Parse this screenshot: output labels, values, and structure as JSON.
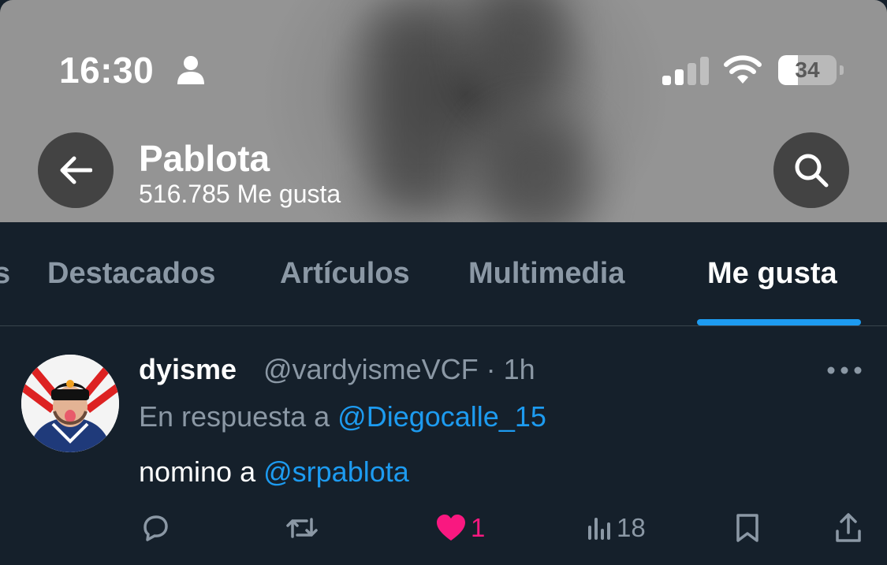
{
  "status_bar": {
    "time": "16:30",
    "battery": "34",
    "battery_level": 0.34
  },
  "header": {
    "profile_name": "Pablota",
    "likes_count": "516.785 Me gusta"
  },
  "tabs": [
    {
      "label": "Destacados",
      "active": false
    },
    {
      "label": "Artículos",
      "active": false
    },
    {
      "label": "Multimedia",
      "active": false
    },
    {
      "label": "Me gusta",
      "active": true
    }
  ],
  "tweet": {
    "author_name": "dyisme",
    "author_handle": "@vardyismeVCF",
    "separator": "·",
    "time": "1h",
    "reply_prefix": "En respuesta a",
    "reply_to": "@Diegocalle_15",
    "text_prefix": "nomino a",
    "mention": "@srpablota",
    "likes": "1",
    "views": "18"
  },
  "colors": {
    "background": "#15202b",
    "accent": "#1d9bf0",
    "like": "#f91880",
    "muted": "#8b98a5"
  },
  "icons": [
    "person-icon",
    "signal-icon",
    "wifi-icon",
    "battery-icon",
    "back-arrow-icon",
    "search-icon",
    "more-icon",
    "reply-icon",
    "retweet-icon",
    "heart-icon",
    "views-icon",
    "bookmark-icon",
    "share-icon"
  ]
}
